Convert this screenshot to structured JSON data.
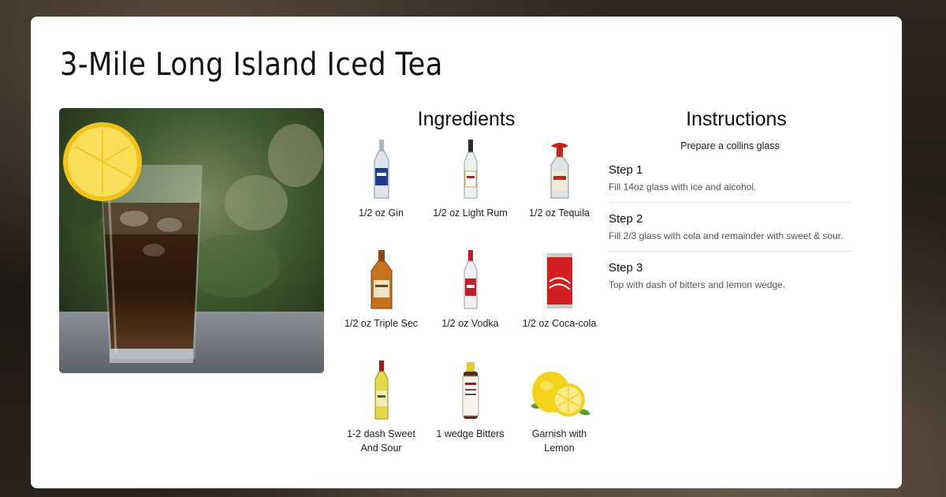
{
  "title": "3-Mile Long Island Iced Tea",
  "ingredients_heading": "Ingredients",
  "instructions_heading": "Instructions",
  "prep_text": "Prepare a collins glass",
  "ingredients": [
    {
      "label": "1/2 oz Gin",
      "icon": "gin-bottle-icon"
    },
    {
      "label": "1/2 oz Light Rum",
      "icon": "rum-bottle-icon"
    },
    {
      "label": "1/2 oz Tequila",
      "icon": "tequila-bottle-icon"
    },
    {
      "label": "1/2 oz Triple Sec",
      "icon": "triple-sec-bottle-icon"
    },
    {
      "label": "1/2 oz Vodka",
      "icon": "vodka-bottle-icon"
    },
    {
      "label": "1/2 oz Coca-cola",
      "icon": "cola-can-icon"
    },
    {
      "label": "1-2 dash Sweet And Sour",
      "icon": "sweet-sour-bottle-icon"
    },
    {
      "label": "1 wedge Bitters",
      "icon": "bitters-bottle-icon"
    },
    {
      "label": "Garnish with Lemon",
      "icon": "lemon-icon"
    }
  ],
  "steps": [
    {
      "title": "Step 1",
      "text": "Fill 14oz glass with ice and alcohol."
    },
    {
      "title": "Step 2",
      "text": "Fill 2/3 glass with cola and remainder with sweet & sour."
    },
    {
      "title": "Step 3",
      "text": "Top with dash of bitters and lemon wedge."
    }
  ]
}
